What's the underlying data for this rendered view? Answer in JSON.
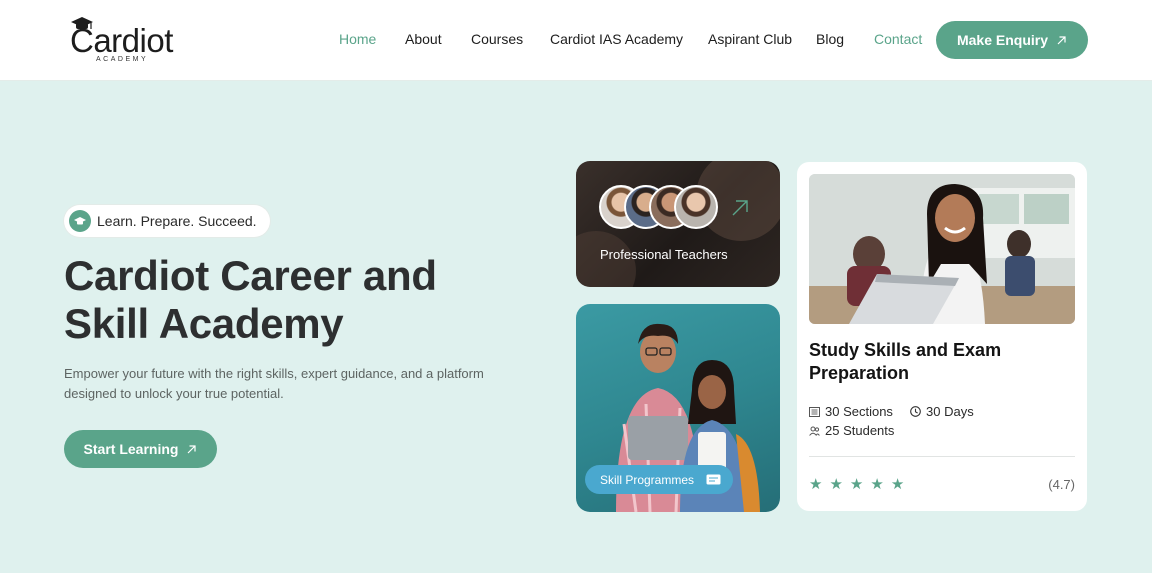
{
  "brand": {
    "name": "Cardiot",
    "tagline": "ACADEMY"
  },
  "nav": {
    "items": [
      {
        "label": "Home",
        "active": true
      },
      {
        "label": "About"
      },
      {
        "label": "Courses"
      },
      {
        "label": "Cardiot  IAS Academy"
      },
      {
        "label": "Aspirant Club"
      },
      {
        "label": "Blog"
      },
      {
        "label": "Contact",
        "active": true
      }
    ],
    "cta_label": "Make Enquiry"
  },
  "hero": {
    "tag": "Learn. Prepare. Succeed.",
    "title": "Cardiot Career and Skill Academy",
    "description": "Empower your future with the right skills, expert guidance, and a platform designed to unlock your true potential.",
    "button_label": "Start Learning"
  },
  "teachers_card": {
    "label": "Professional Teachers"
  },
  "skill_card": {
    "badge": "Skill Programmes"
  },
  "course_card": {
    "title": "Study Skills and Exam Preparation",
    "sections": "30 Sections",
    "duration": "30 Days",
    "students": "25 Students",
    "rating_stars": 5,
    "rating_value": "(4.7)"
  },
  "colors": {
    "accent": "#5aa48a",
    "background": "#dff1ee",
    "badge_blue": "#4aa8cf"
  },
  "icons": [
    "graduation-cap-icon",
    "arrow-up-right-icon",
    "ticket-icon",
    "book-icon",
    "clock-icon",
    "users-icon",
    "star-icon"
  ]
}
